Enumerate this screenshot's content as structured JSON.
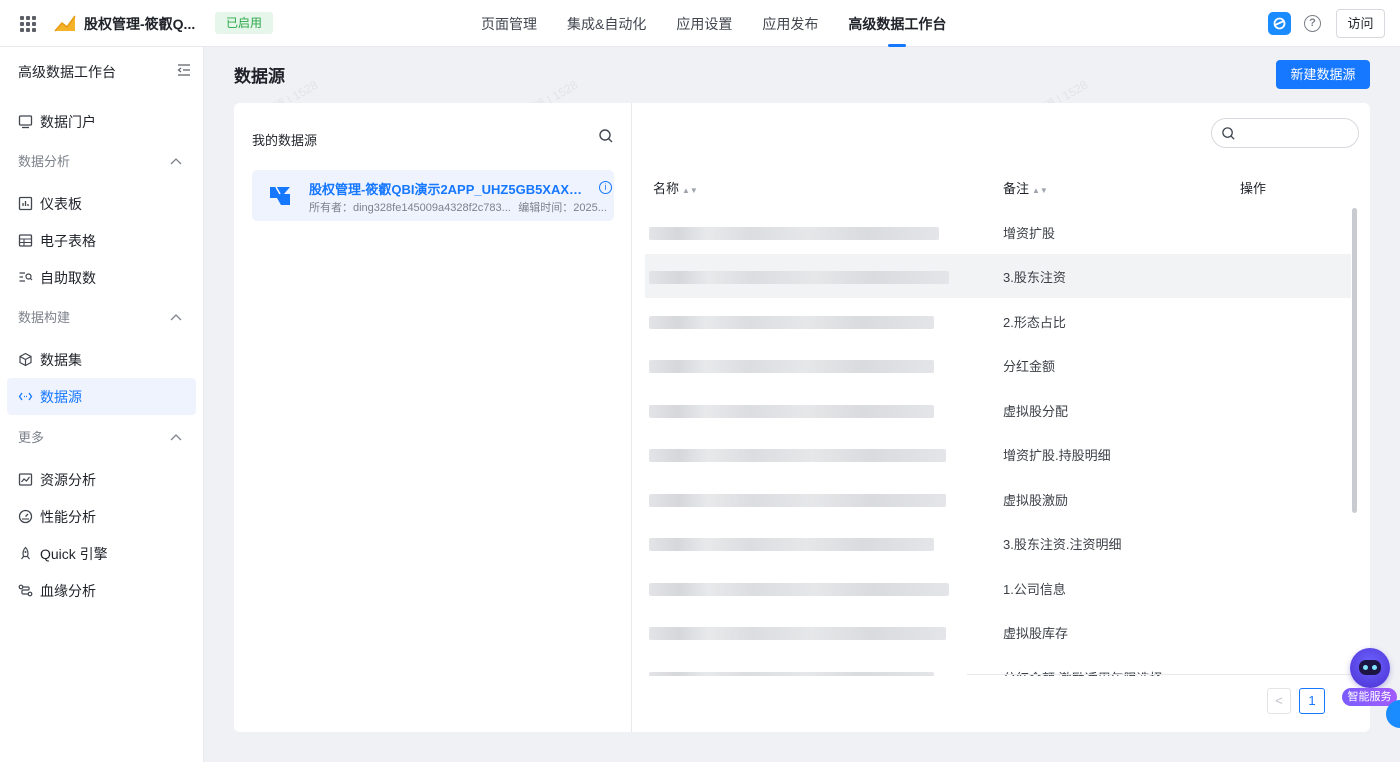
{
  "topbar": {
    "app_title": "股权管理-筱叡Q...",
    "status": "已启用",
    "nav": [
      {
        "label": "页面管理",
        "active": false
      },
      {
        "label": "集成&自动化",
        "active": false
      },
      {
        "label": "应用设置",
        "active": false
      },
      {
        "label": "应用发布",
        "active": false
      },
      {
        "label": "高级数据工作台",
        "active": true
      }
    ],
    "visit_label": "访问",
    "help_glyph": "?"
  },
  "sidebar": {
    "title": "高级数据工作台",
    "portal": "数据门户",
    "group_analysis": "数据分析",
    "dashboard": "仪表板",
    "spreadsheet": "电子表格",
    "self_fetch": "自助取数",
    "group_build": "数据构建",
    "dataset": "数据集",
    "datasource": "数据源",
    "group_more": "更多",
    "resource": "资源分析",
    "performance": "性能分析",
    "quick": "Quick 引擎",
    "lineage": "血缘分析"
  },
  "main": {
    "page_title": "数据源",
    "new_button": "新建数据源",
    "my_datasources": "我的数据源",
    "card": {
      "name": "股权管理-筱叡QBI演示2APP_UHZ5GB5XAXQ...",
      "owner": "所有者：ding328fe145009a4328f2c783...",
      "edit_time": "编辑时间：2025...",
      "info_glyph": "i"
    },
    "table": {
      "col_name": "名称",
      "col_remark": "备注",
      "col_action": "操作",
      "rows": [
        {
          "remark": "增资扩股"
        },
        {
          "remark": "3.股东注资"
        },
        {
          "remark": "2.形态占比"
        },
        {
          "remark": "分红金额"
        },
        {
          "remark": "虚拟股分配"
        },
        {
          "remark": "增资扩股.持股明细"
        },
        {
          "remark": "虚拟股激励"
        },
        {
          "remark": "3.股东注资.注资明细"
        },
        {
          "remark": "1.公司信息"
        },
        {
          "remark": "虚拟股库存"
        },
        {
          "remark": "分红金额.激励适用年限选择"
        }
      ]
    },
    "pager": {
      "prev": "<",
      "current": "1"
    }
  },
  "assistant": {
    "label": "智能服务"
  },
  "colors": {
    "accent": "#1677ff",
    "status_green": "#2ba84a"
  }
}
